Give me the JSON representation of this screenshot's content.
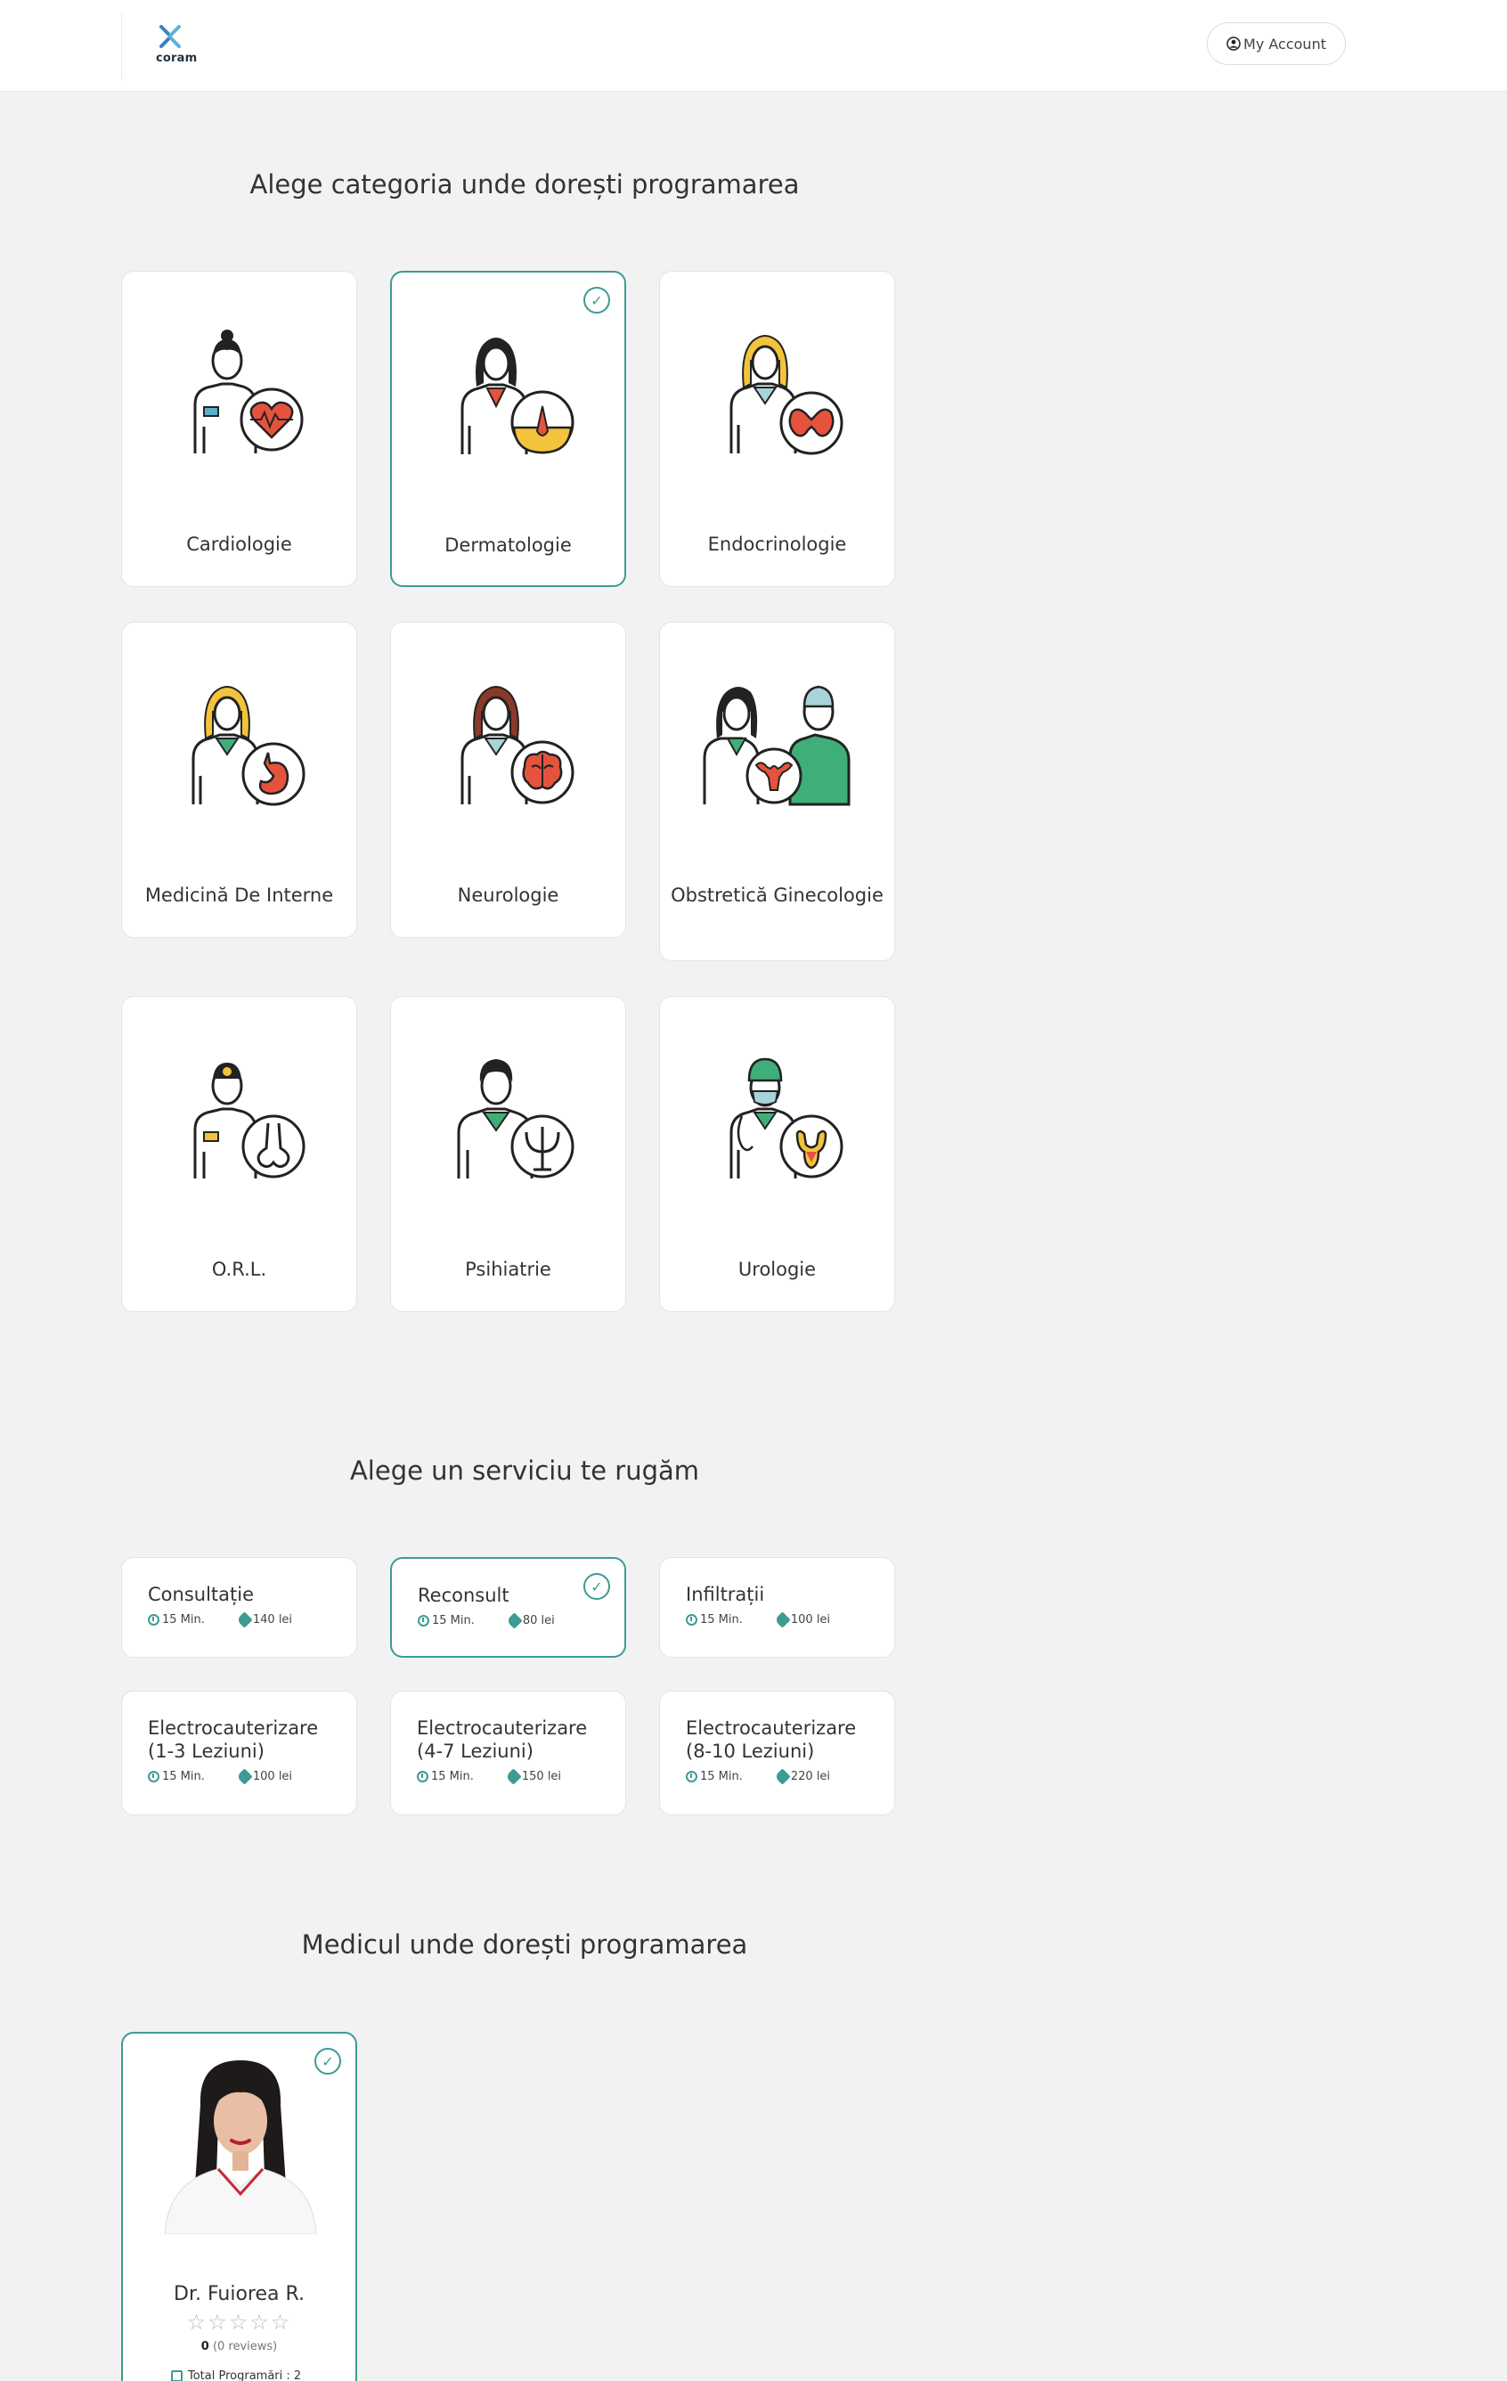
{
  "header": {
    "logo_text": "coram",
    "account_label": "My Account"
  },
  "categories": {
    "title": "Alege categoria unde dorești programarea",
    "items": [
      {
        "label": "Cardiologie",
        "selected": false
      },
      {
        "label": "Dermatologie",
        "selected": true
      },
      {
        "label": "Endocrinologie",
        "selected": false
      },
      {
        "label": "Medicină De Interne",
        "selected": false
      },
      {
        "label": "Neurologie",
        "selected": false
      },
      {
        "label": "Obstretică Ginecologie",
        "selected": false
      },
      {
        "label": "O.R.L.",
        "selected": false
      },
      {
        "label": "Psihiatrie",
        "selected": false
      },
      {
        "label": "Urologie",
        "selected": false
      }
    ]
  },
  "services": {
    "title": "Alege un serviciu te rugăm",
    "items": [
      {
        "name": "Consultație",
        "duration": "15 Min.",
        "price": "140 lei",
        "selected": false
      },
      {
        "name": "Reconsult",
        "duration": "15 Min.",
        "price": "80 lei",
        "selected": true
      },
      {
        "name": "Infiltrații",
        "duration": "15 Min.",
        "price": "100 lei",
        "selected": false
      },
      {
        "name": "Electrocauterizare (1-3 Leziuni)",
        "duration": "15 Min.",
        "price": "100 lei",
        "selected": false
      },
      {
        "name": "Electrocauterizare (4-7 Leziuni)",
        "duration": "15 Min.",
        "price": "150 lei",
        "selected": false
      },
      {
        "name": "Electrocauterizare (8-10 Leziuni)",
        "duration": "15 Min.",
        "price": "220 lei",
        "selected": false
      }
    ]
  },
  "doctors": {
    "title": "Medicul unde dorești programarea",
    "items": [
      {
        "name": "Dr. Fuiorea R.",
        "rating": 0,
        "stars": "☆☆☆☆☆",
        "rating_value": "0",
        "reviews": "(0 reviews)",
        "total": "Total Programări : 2",
        "selected": true
      }
    ]
  },
  "colors": {
    "accent": "#3d9b93",
    "background": "#f2f2f2",
    "card": "#ffffff"
  }
}
